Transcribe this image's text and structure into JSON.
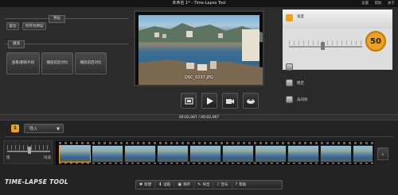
{
  "window": {
    "title": "未命名 1* - Time-Lapse Tool",
    "controls": [
      "设置",
      "帮助",
      "关于"
    ]
  },
  "left_panel": {
    "section_reset": "预设",
    "reset_button": "复位",
    "save_preset_button": "另存为预设",
    "section_playback": "播放",
    "playback_buttons": [
      "查看/删除片段",
      "播放前后对比",
      "播放前后对比"
    ]
  },
  "preview": {
    "caption": "DSC_0237.JPG"
  },
  "timecode": "00:02,067 / 00:02,067",
  "right_panel": {
    "speed_label": "速度",
    "speed_value": "50",
    "options": [
      "抗锯化",
      "稳定",
      "去闪烁"
    ]
  },
  "import_bar": {
    "badge": "1",
    "import_label": "导入"
  },
  "speed_control": {
    "slow_label": "慢",
    "fast_label": "快速"
  },
  "app_logo": "TIME-LAPSE TOOL",
  "bottom_bar": {
    "items": [
      "新建",
      "读取",
      "保存",
      "导出",
      "音乐",
      "帮助"
    ]
  },
  "colors": {
    "accent": "#f0a01a",
    "background": "#2b2b2b"
  }
}
